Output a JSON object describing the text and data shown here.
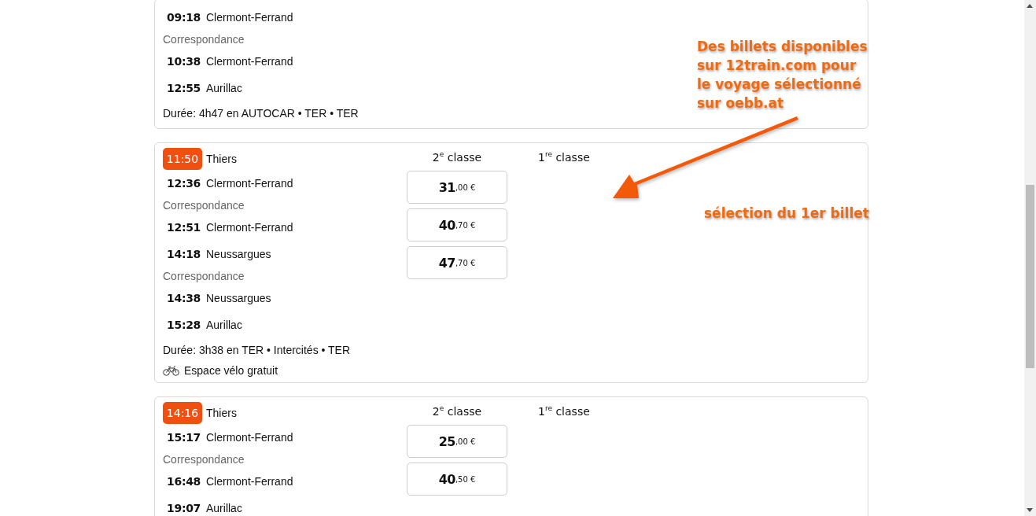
{
  "journeys": [
    {
      "stops": [
        {
          "kind": "stop",
          "time": "09:18",
          "place": "Clermont-Ferrand"
        },
        {
          "kind": "connection",
          "label": "Correspondance"
        },
        {
          "kind": "stop",
          "time": "10:38",
          "place": "Clermont-Ferrand"
        },
        {
          "kind": "stop",
          "time": "12:55",
          "place": "Aurillac"
        }
      ],
      "duration": "Durée: 4h47 en AUTOCAR • TER • TER"
    },
    {
      "badge": {
        "time": "11:50",
        "place": "Thiers"
      },
      "stops": [
        {
          "kind": "stop",
          "time": "12:36",
          "place": "Clermont-Ferrand"
        },
        {
          "kind": "connection",
          "label": "Correspondance"
        },
        {
          "kind": "stop",
          "time": "12:51",
          "place": "Clermont-Ferrand"
        },
        {
          "kind": "stop",
          "time": "14:18",
          "place": "Neussargues"
        },
        {
          "kind": "connection",
          "label": "Correspondance"
        },
        {
          "kind": "stop",
          "time": "14:38",
          "place": "Neussargues"
        },
        {
          "kind": "stop",
          "time": "15:28",
          "place": "Aurillac"
        }
      ],
      "duration": "Durée: 3h38 en TER • Intercités • TER",
      "amenity": "Espace vélo gratuit",
      "classes": [
        "2$^{e}$ classe",
        "1$^{re}$ classe"
      ],
      "fares": [
        {
          "amount": "31",
          "decimals": ",00 €"
        },
        {
          "amount": "40",
          "decimals": ",70 €"
        },
        {
          "amount": "47",
          "decimals": ",70 €"
        }
      ]
    },
    {
      "badge": {
        "time": "14:16",
        "place": "Thiers"
      },
      "stops": [
        {
          "kind": "stop",
          "time": "15:17",
          "place": "Clermont-Ferrand"
        },
        {
          "kind": "connection",
          "label": "Correspondance"
        },
        {
          "kind": "stop",
          "time": "16:48",
          "place": "Clermont-Ferrand"
        },
        {
          "kind": "stop",
          "time": "19:07",
          "place": "Aurillac"
        }
      ],
      "classes": [
        "2$^{e}$ classe",
        "1$^{re}$ classe"
      ],
      "fares": [
        {
          "amount": "25",
          "decimals": ",00 €"
        },
        {
          "amount": "40",
          "decimals": ",50 €"
        }
      ]
    }
  ],
  "annotation": {
    "note": "Des billets disponibles sur 12train.com pour le voyage sélectionné sur oebb.at",
    "caption": "sélection du 1er billet"
  }
}
